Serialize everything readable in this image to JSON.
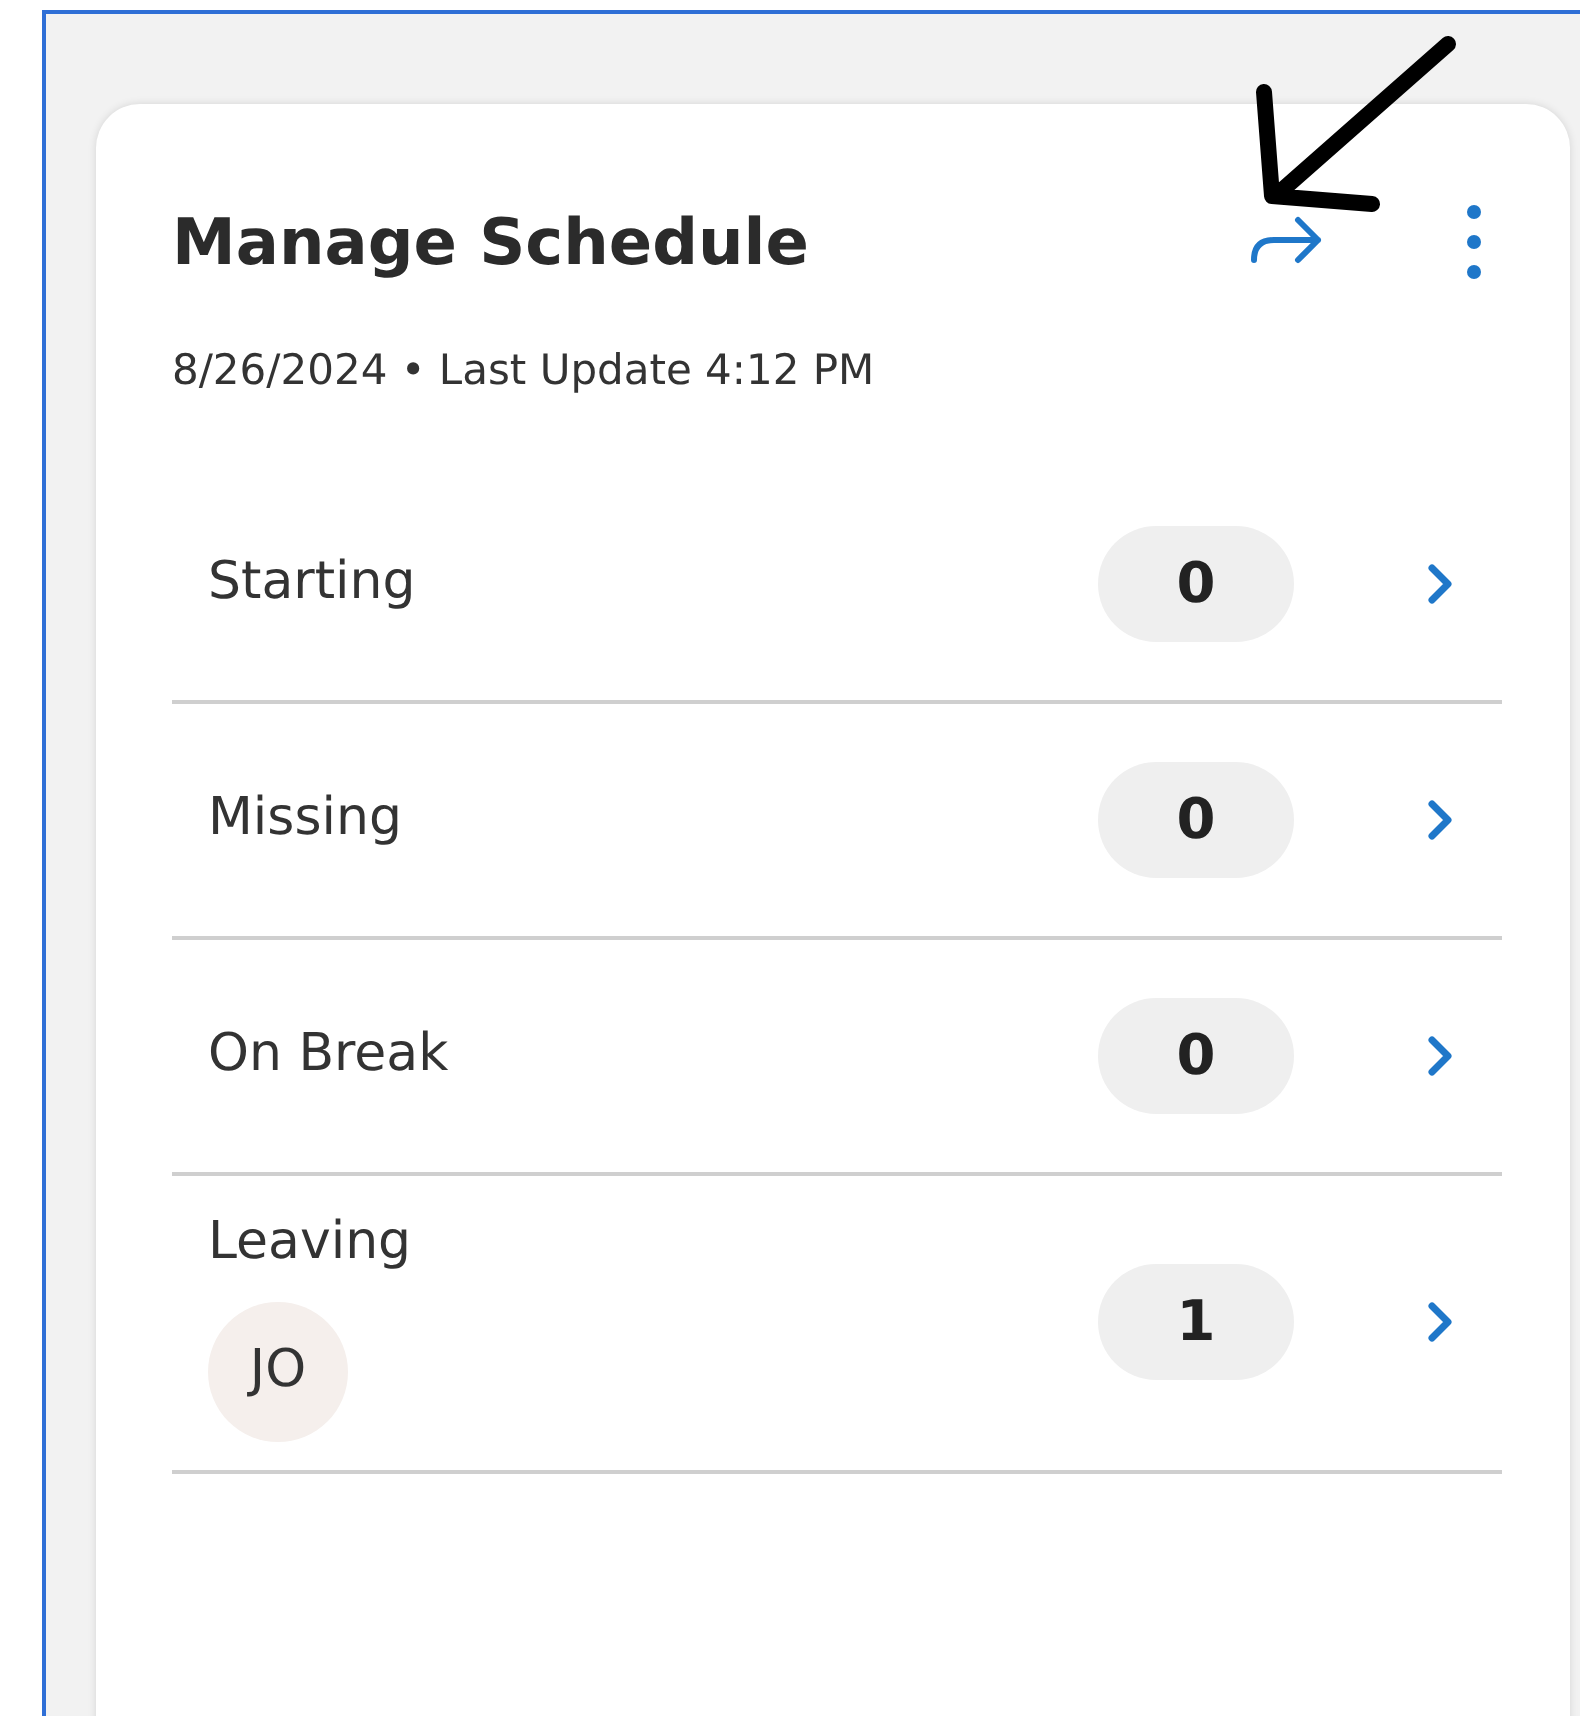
{
  "card": {
    "title": "Manage Schedule",
    "subtitle": "8/26/2024 • Last Update 4:12 PM",
    "rows": [
      {
        "label": "Starting",
        "count": "0"
      },
      {
        "label": "Missing",
        "count": "0"
      },
      {
        "label": "On Break",
        "count": "0"
      },
      {
        "label": "Leaving",
        "count": "1",
        "avatars": [
          "JO"
        ]
      }
    ]
  }
}
